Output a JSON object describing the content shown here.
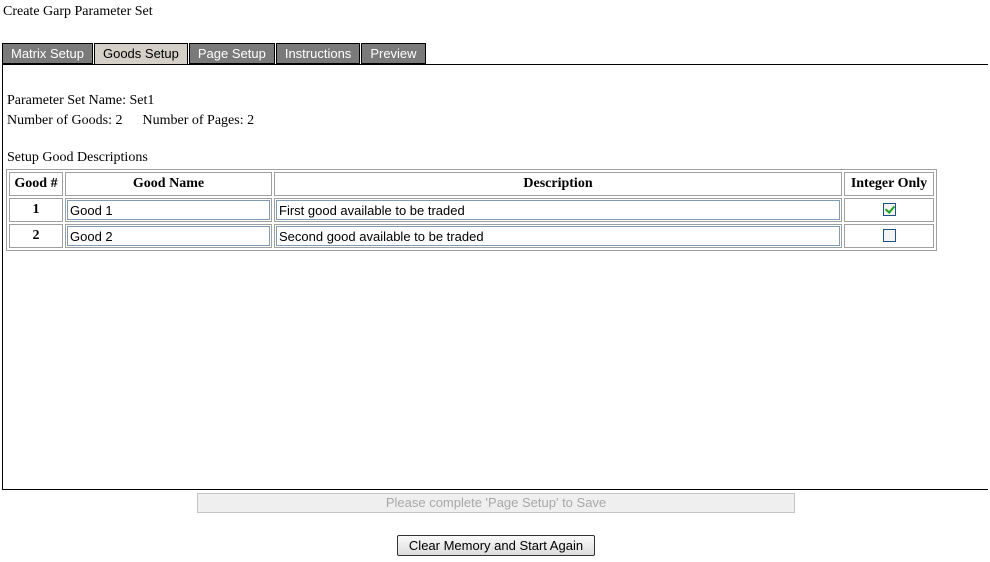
{
  "page": {
    "title": "Create Garp Parameter Set"
  },
  "tabs": [
    {
      "label": "Matrix Setup",
      "active": false
    },
    {
      "label": "Goods Setup",
      "active": true
    },
    {
      "label": "Page Setup",
      "active": false
    },
    {
      "label": "Instructions",
      "active": false
    },
    {
      "label": "Preview",
      "active": false
    }
  ],
  "info": {
    "parameter_set_name": "Parameter Set Name: Set1",
    "number_of_goods": "Number of Goods: 2",
    "number_of_pages": "Number of Pages: 2"
  },
  "goods_section": {
    "label": "Setup Good Descriptions",
    "columns": [
      "Good #",
      "Good Name",
      "Description",
      "Integer Only"
    ],
    "rows": [
      {
        "num": "1",
        "name": "Good 1",
        "description": "First good available to be traded",
        "integer_only": true
      },
      {
        "num": "2",
        "name": "Good 2",
        "description": "Second good available to be traded",
        "integer_only": false
      }
    ]
  },
  "buttons": {
    "save_label": "Please complete 'Page Setup' to Save",
    "clear_label": "Clear Memory and Start Again"
  }
}
